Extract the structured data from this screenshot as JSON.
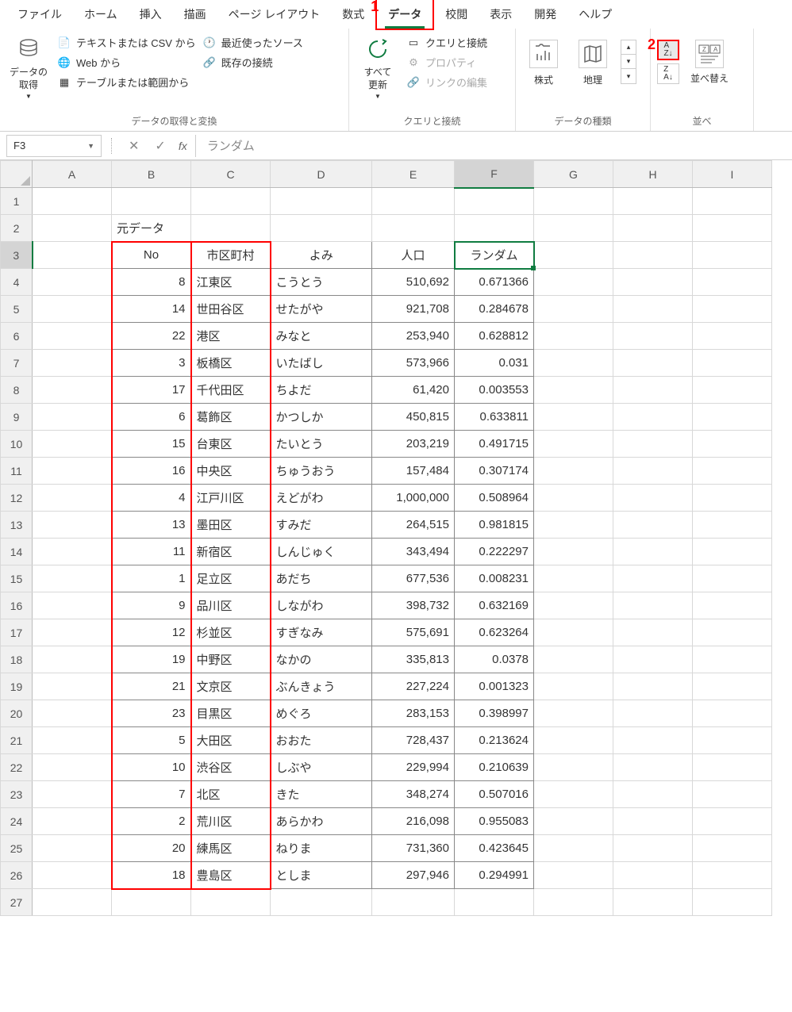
{
  "tabs": [
    "ファイル",
    "ホーム",
    "挿入",
    "描画",
    "ページ レイアウト",
    "数式",
    "データ",
    "校閲",
    "表示",
    "開発",
    "ヘルプ"
  ],
  "active_tab": "データ",
  "ribbon": {
    "group1_label": "データの取得と変換",
    "get_data": "データの\n取得",
    "from_csv": "テキストまたは CSV から",
    "from_web": "Web から",
    "from_table": "テーブルまたは範囲から",
    "recent_source": "最近使ったソース",
    "existing_conn": "既存の接続",
    "group2_label": "クエリと接続",
    "refresh_all": "すべて\n更新",
    "queries_conn": "クエリと接続",
    "properties": "プロパティ",
    "edit_links": "リンクの編集",
    "group3_label": "データの種類",
    "stocks": "株式",
    "geography": "地理",
    "group4_label": "並べ",
    "sort": "並べ替え"
  },
  "name_box": "F3",
  "formula": "ランダム",
  "annotations": {
    "one": "1",
    "two": "2"
  },
  "cols": [
    "A",
    "B",
    "C",
    "D",
    "E",
    "F",
    "G",
    "H",
    "I"
  ],
  "label_source": "元データ",
  "headers": {
    "no": "No",
    "ward": "市区町村",
    "yomi": "よみ",
    "pop": "人口",
    "rand": "ランダム"
  },
  "rows": [
    {
      "no": 8,
      "ward": "江東区",
      "yomi": "こうとう",
      "pop": "510,692",
      "rand": "0.671366"
    },
    {
      "no": 14,
      "ward": "世田谷区",
      "yomi": "せたがや",
      "pop": "921,708",
      "rand": "0.284678"
    },
    {
      "no": 22,
      "ward": "港区",
      "yomi": "みなと",
      "pop": "253,940",
      "rand": "0.628812"
    },
    {
      "no": 3,
      "ward": "板橋区",
      "yomi": "いたばし",
      "pop": "573,966",
      "rand": "0.031"
    },
    {
      "no": 17,
      "ward": "千代田区",
      "yomi": "ちよだ",
      "pop": "61,420",
      "rand": "0.003553"
    },
    {
      "no": 6,
      "ward": "葛飾区",
      "yomi": "かつしか",
      "pop": "450,815",
      "rand": "0.633811"
    },
    {
      "no": 15,
      "ward": "台東区",
      "yomi": "たいとう",
      "pop": "203,219",
      "rand": "0.491715"
    },
    {
      "no": 16,
      "ward": "中央区",
      "yomi": "ちゅうおう",
      "pop": "157,484",
      "rand": "0.307174"
    },
    {
      "no": 4,
      "ward": "江戸川区",
      "yomi": "えどがわ",
      "pop": "1,000,000",
      "rand": "0.508964"
    },
    {
      "no": 13,
      "ward": "墨田区",
      "yomi": "すみだ",
      "pop": "264,515",
      "rand": "0.981815"
    },
    {
      "no": 11,
      "ward": "新宿区",
      "yomi": "しんじゅく",
      "pop": "343,494",
      "rand": "0.222297"
    },
    {
      "no": 1,
      "ward": "足立区",
      "yomi": "あだち",
      "pop": "677,536",
      "rand": "0.008231"
    },
    {
      "no": 9,
      "ward": "品川区",
      "yomi": "しながわ",
      "pop": "398,732",
      "rand": "0.632169"
    },
    {
      "no": 12,
      "ward": "杉並区",
      "yomi": "すぎなみ",
      "pop": "575,691",
      "rand": "0.623264"
    },
    {
      "no": 19,
      "ward": "中野区",
      "yomi": "なかの",
      "pop": "335,813",
      "rand": "0.0378"
    },
    {
      "no": 21,
      "ward": "文京区",
      "yomi": "ぶんきょう",
      "pop": "227,224",
      "rand": "0.001323"
    },
    {
      "no": 23,
      "ward": "目黒区",
      "yomi": "めぐろ",
      "pop": "283,153",
      "rand": "0.398997"
    },
    {
      "no": 5,
      "ward": "大田区",
      "yomi": "おおた",
      "pop": "728,437",
      "rand": "0.213624"
    },
    {
      "no": 10,
      "ward": "渋谷区",
      "yomi": "しぶや",
      "pop": "229,994",
      "rand": "0.210639"
    },
    {
      "no": 7,
      "ward": "北区",
      "yomi": "きた",
      "pop": "348,274",
      "rand": "0.507016"
    },
    {
      "no": 2,
      "ward": "荒川区",
      "yomi": "あらかわ",
      "pop": "216,098",
      "rand": "0.955083"
    },
    {
      "no": 20,
      "ward": "練馬区",
      "yomi": "ねりま",
      "pop": "731,360",
      "rand": "0.423645"
    },
    {
      "no": 18,
      "ward": "豊島区",
      "yomi": "としま",
      "pop": "297,946",
      "rand": "0.294991"
    }
  ]
}
